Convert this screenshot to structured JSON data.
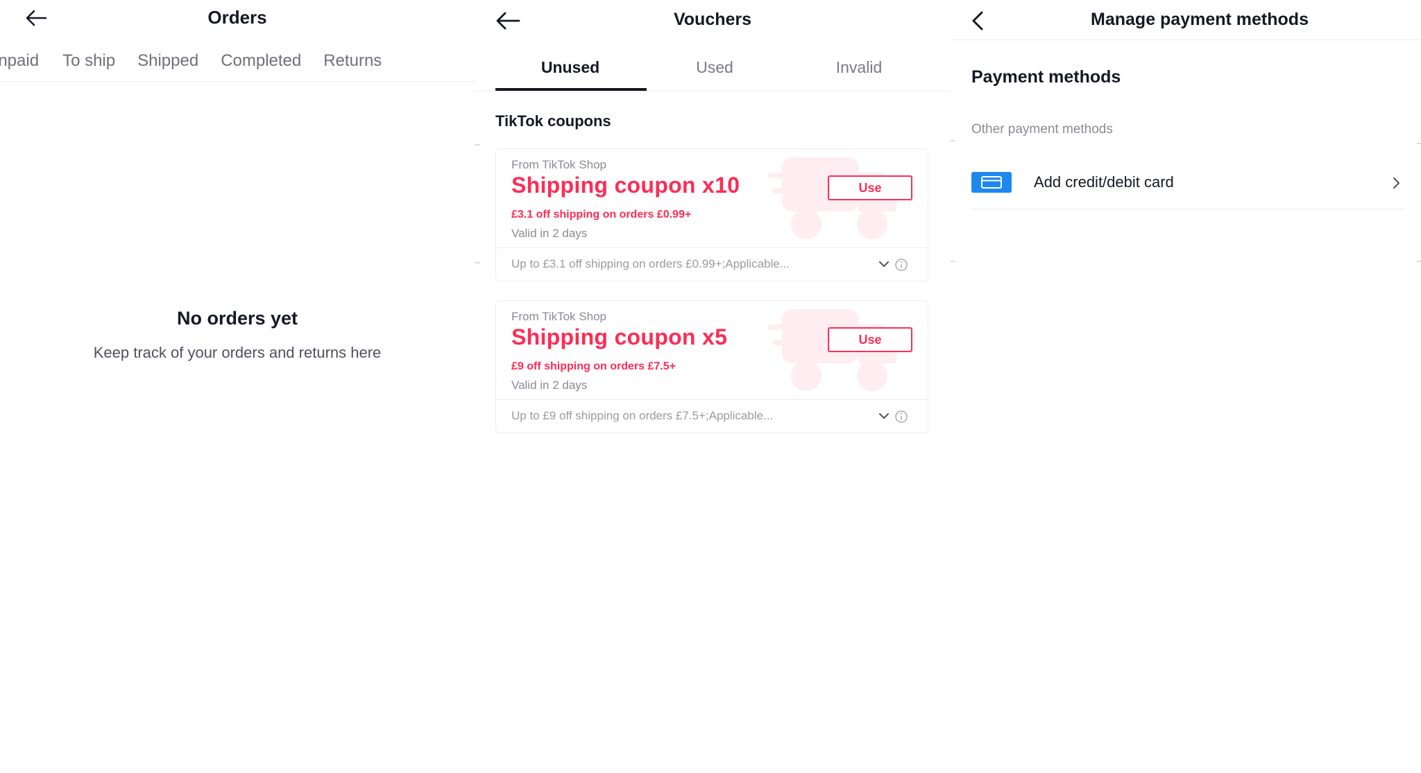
{
  "orders": {
    "title": "Orders",
    "tabs": [
      "Unpaid",
      "To ship",
      "Shipped",
      "Completed",
      "Returns"
    ],
    "empty_title": "No orders yet",
    "empty_subtitle": "Keep track of your orders and returns here"
  },
  "vouchers": {
    "title": "Vouchers",
    "tabs": [
      "Unused",
      "Used",
      "Invalid"
    ],
    "active_tab": "Unused",
    "section_title": "TikTok coupons",
    "coupons": [
      {
        "from": "From TikTok Shop",
        "title": "Shipping coupon x10",
        "terms": "£3.1 off shipping on orders £0.99+",
        "validity": "Valid in 2 days",
        "button": "Use",
        "details": "Up to £3.1 off shipping on orders £0.99+;Applicable..."
      },
      {
        "from": "From TikTok Shop",
        "title": "Shipping coupon x5",
        "terms": "£9 off shipping on orders £7.5+",
        "validity": "Valid in 2 days",
        "button": "Use",
        "details": "Up to £9 off shipping on orders £7.5+;Applicable..."
      }
    ]
  },
  "payments": {
    "title": "Manage payment methods",
    "section_title": "Payment methods",
    "subsection": "Other payment methods",
    "items": [
      {
        "label": "Add credit/debit card",
        "icon": "credit-card-icon"
      }
    ]
  },
  "colors": {
    "accent": "#fe2c55",
    "card_icon": "#1e88f0",
    "text_primary": "#161823",
    "text_secondary": "#8a8b92"
  }
}
